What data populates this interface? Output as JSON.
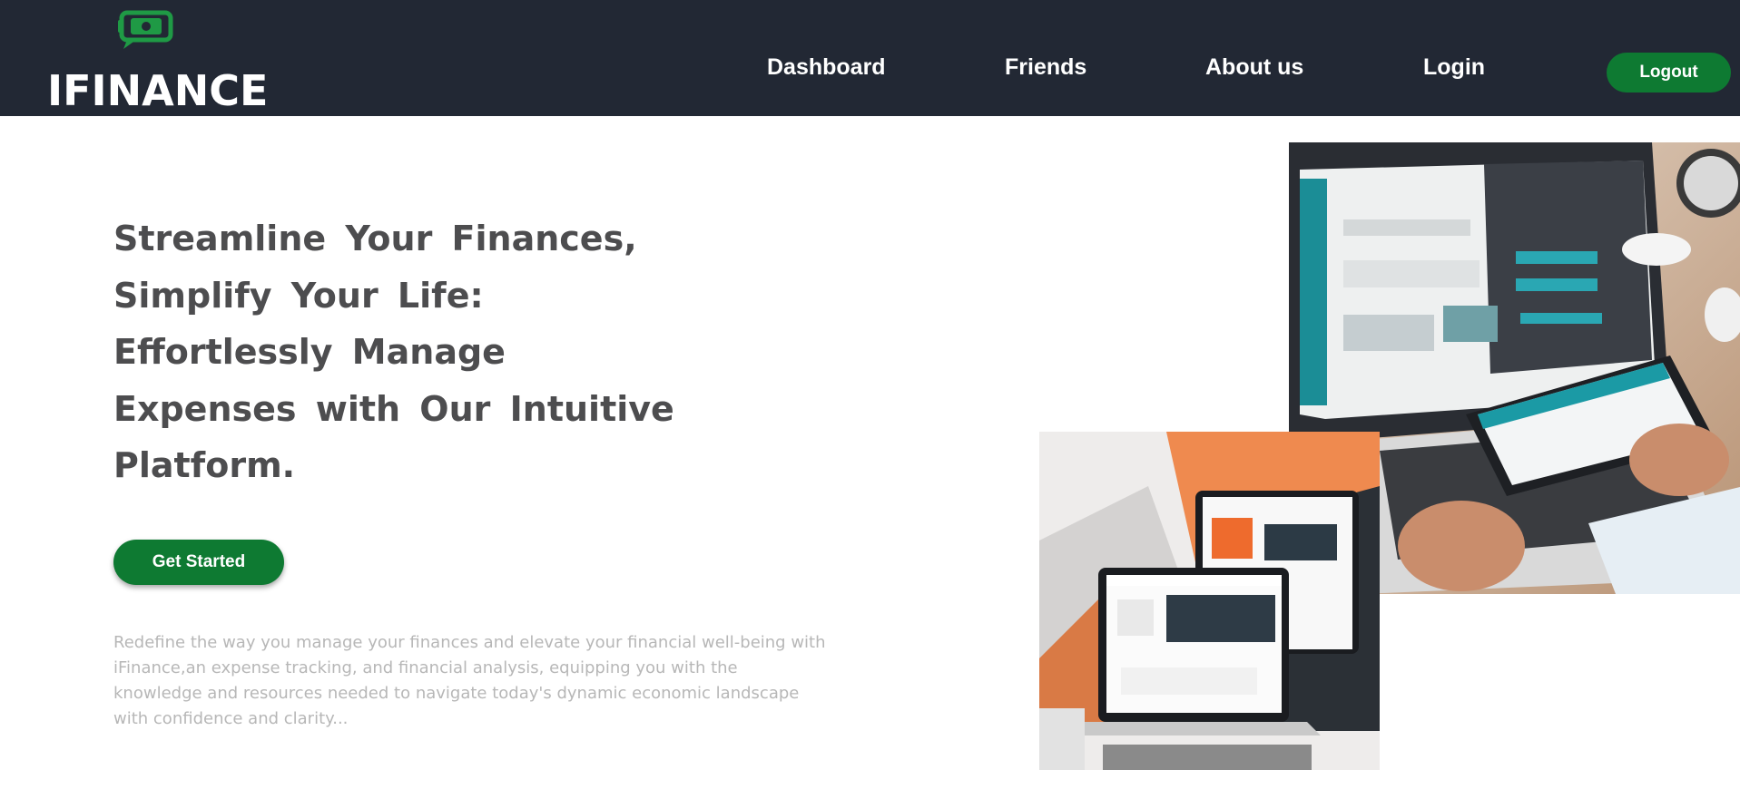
{
  "brand": {
    "name": "IFINANCE",
    "logo_icon": "money-chat-icon",
    "accent_color": "#0e7a32",
    "nav_bg_color": "#222834"
  },
  "nav": {
    "links": [
      "Dashboard",
      "Friends",
      "About us",
      "Login"
    ],
    "logout_label": "Logout"
  },
  "hero": {
    "headline_lines": [
      "Streamline Your Finances,",
      "Simplify Your Life:",
      "Effortlessly Manage",
      "Expenses with Our Intuitive",
      "Platform."
    ],
    "cta_label": "Get Started",
    "description": "Redefine the way you manage your finances and elevate your financial well-being with iFinance,an expense tracking, and financial analysis, equipping you with the knowledge and resources needed to navigate today's dynamic economic landscape with confidence and clarity..."
  }
}
